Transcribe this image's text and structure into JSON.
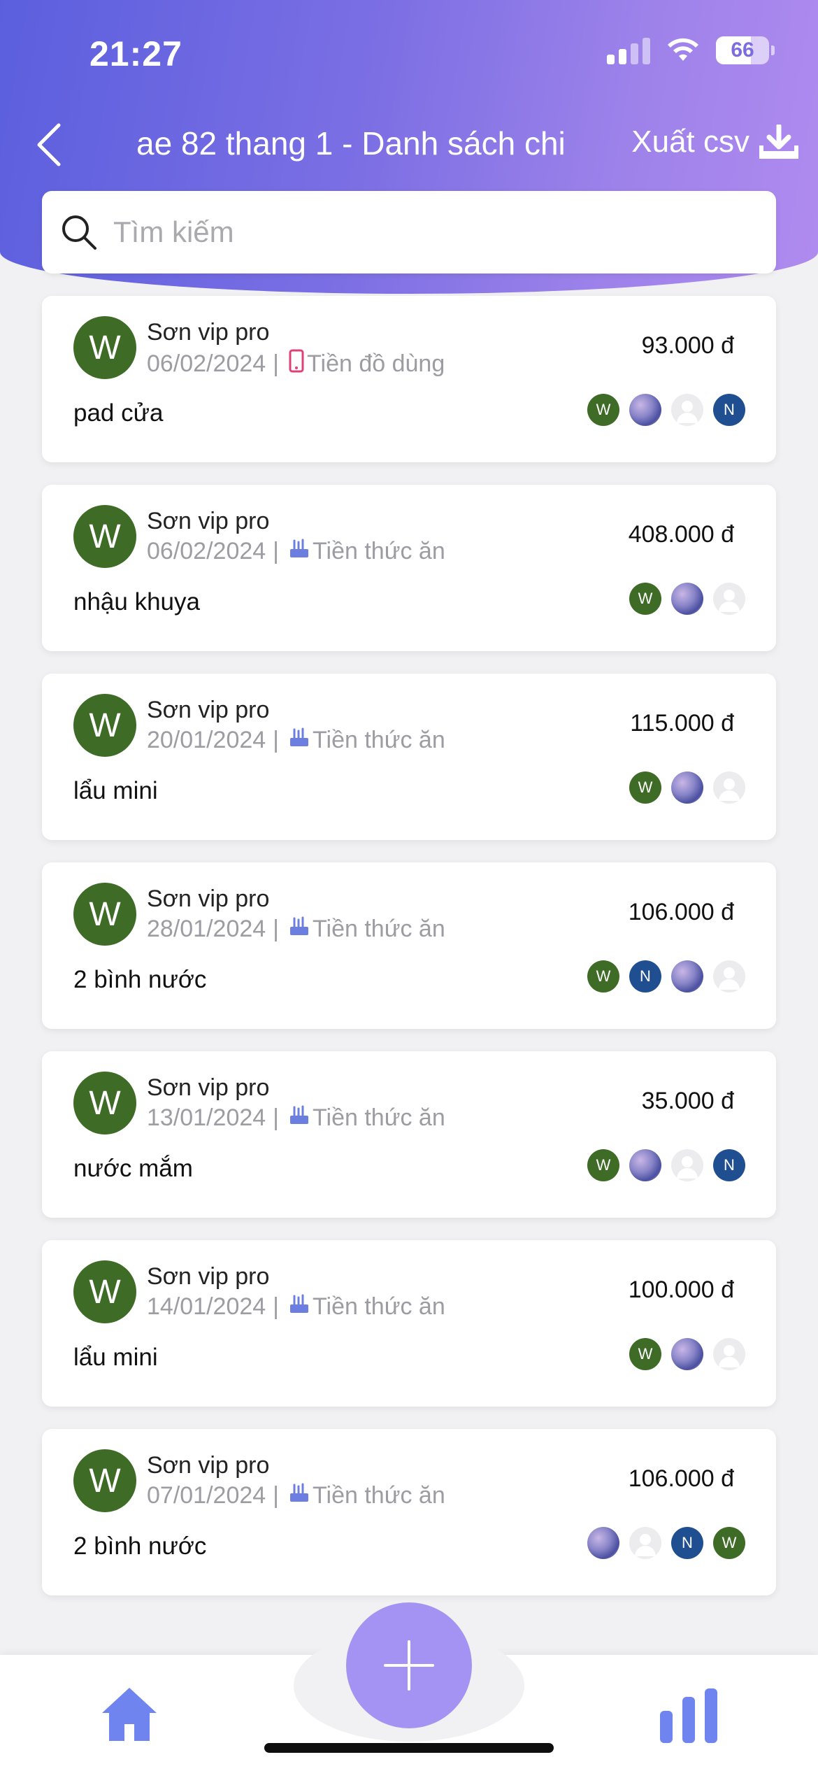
{
  "status_bar": {
    "time": "21:27",
    "battery": "66"
  },
  "header": {
    "title": "ae 82 thang 1 - Danh sách chi",
    "export_label": "Xuất csv"
  },
  "search": {
    "placeholder": "Tìm kiếm"
  },
  "colors": {
    "accent": "#a493f2",
    "payer_avatar": "#3e6b25",
    "member_n": "#1f4f91"
  },
  "expenses": [
    {
      "payer": "Sơn vip pro",
      "payer_initial": "W",
      "date": "06/02/2024",
      "category": "Tiền đồ dùng",
      "category_icon": "phone-icon",
      "amount": "93.000 đ",
      "description": "pad cửa",
      "members": [
        "W",
        "photo",
        "blank",
        "N"
      ]
    },
    {
      "payer": "Sơn vip pro",
      "payer_initial": "W",
      "date": "06/02/2024",
      "category": "Tiền thức ăn",
      "category_icon": "food-icon",
      "amount": "408.000 đ",
      "description": "nhậu khuya",
      "members": [
        "W",
        "photo",
        "blank"
      ]
    },
    {
      "payer": "Sơn vip pro",
      "payer_initial": "W",
      "date": "20/01/2024",
      "category": "Tiền thức ăn",
      "category_icon": "food-icon",
      "amount": "115.000 đ",
      "description": "lẩu mini",
      "members": [
        "W",
        "photo",
        "blank"
      ]
    },
    {
      "payer": "Sơn vip pro",
      "payer_initial": "W",
      "date": "28/01/2024",
      "category": "Tiền thức ăn",
      "category_icon": "food-icon",
      "amount": "106.000 đ",
      "description": "2 bình nước",
      "members": [
        "W",
        "N",
        "photo",
        "blank"
      ]
    },
    {
      "payer": "Sơn vip pro",
      "payer_initial": "W",
      "date": "13/01/2024",
      "category": "Tiền thức ăn",
      "category_icon": "food-icon",
      "amount": "35.000 đ",
      "description": "nước mắm",
      "members": [
        "W",
        "photo",
        "blank",
        "N"
      ]
    },
    {
      "payer": "Sơn vip pro",
      "payer_initial": "W",
      "date": "14/01/2024",
      "category": "Tiền thức ăn",
      "category_icon": "food-icon",
      "amount": "100.000 đ",
      "description": "lẩu mini",
      "members": [
        "W",
        "photo",
        "blank"
      ]
    },
    {
      "payer": "Sơn vip pro",
      "payer_initial": "W",
      "date": "07/01/2024",
      "category": "Tiền thức ăn",
      "category_icon": "food-icon",
      "amount": "106.000 đ",
      "description": "2 bình nước",
      "members": [
        "photo",
        "blank",
        "N",
        "W"
      ]
    }
  ],
  "bottom_nav": {
    "left_icon": "home-icon",
    "center_icon": "plus-icon",
    "right_icon": "bar-chart-icon"
  }
}
